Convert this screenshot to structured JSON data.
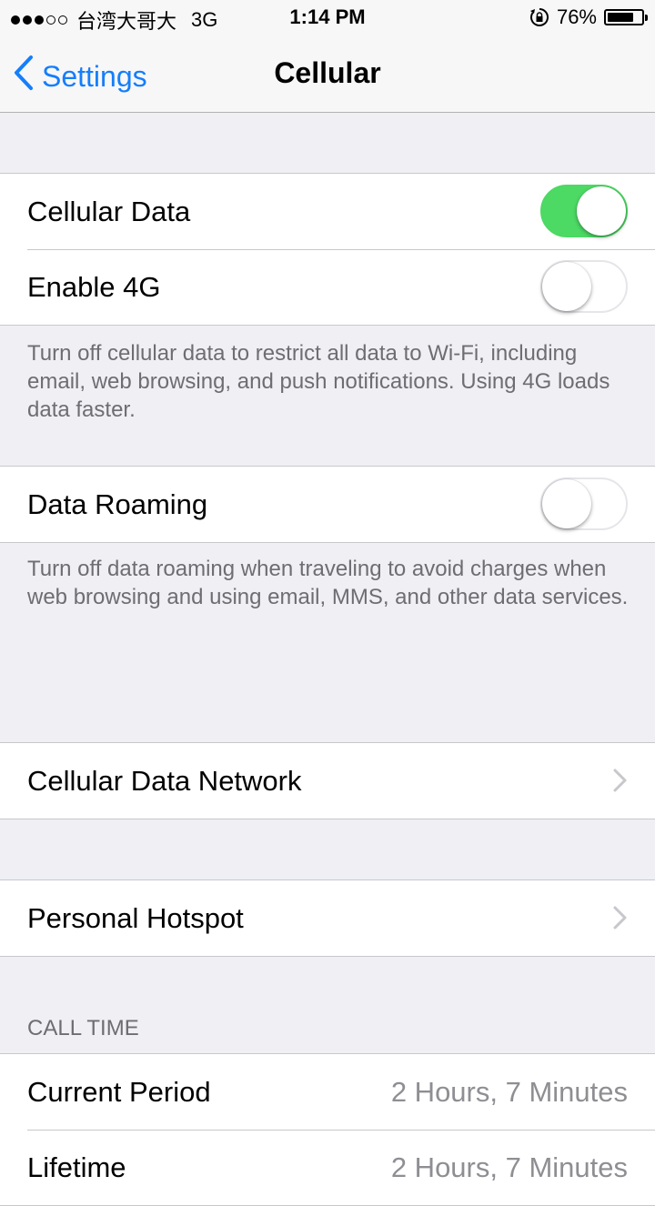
{
  "status_bar": {
    "carrier": "台湾大哥大",
    "network": "3G",
    "time": "1:14 PM",
    "battery": "76%",
    "battery_level": 0.76,
    "signal_dots_filled": 3,
    "signal_dots_total": 5
  },
  "nav": {
    "back_label": "Settings",
    "title": "Cellular"
  },
  "group1": {
    "cellular_data_label": "Cellular Data",
    "cellular_data_on": true,
    "enable_4g_label": "Enable 4G",
    "enable_4g_on": false,
    "footer": "Turn off cellular data to restrict all data to Wi-Fi, including email, web browsing, and push notifications. Using 4G loads data faster."
  },
  "group2": {
    "data_roaming_label": "Data Roaming",
    "data_roaming_on": false,
    "footer": "Turn off data roaming when traveling to avoid charges when web browsing and using email, MMS, and other data services."
  },
  "group3": {
    "cellular_data_network_label": "Cellular Data Network"
  },
  "group4": {
    "personal_hotspot_label": "Personal Hotspot"
  },
  "call_time": {
    "header": "CALL TIME",
    "current_period_label": "Current Period",
    "current_period_value": "2 Hours, 7 Minutes",
    "lifetime_label": "Lifetime",
    "lifetime_value": "2 Hours, 7 Minutes"
  },
  "colors": {
    "accent": "#157efb",
    "toggle_on": "#4cd964",
    "background": "#efeff4"
  }
}
